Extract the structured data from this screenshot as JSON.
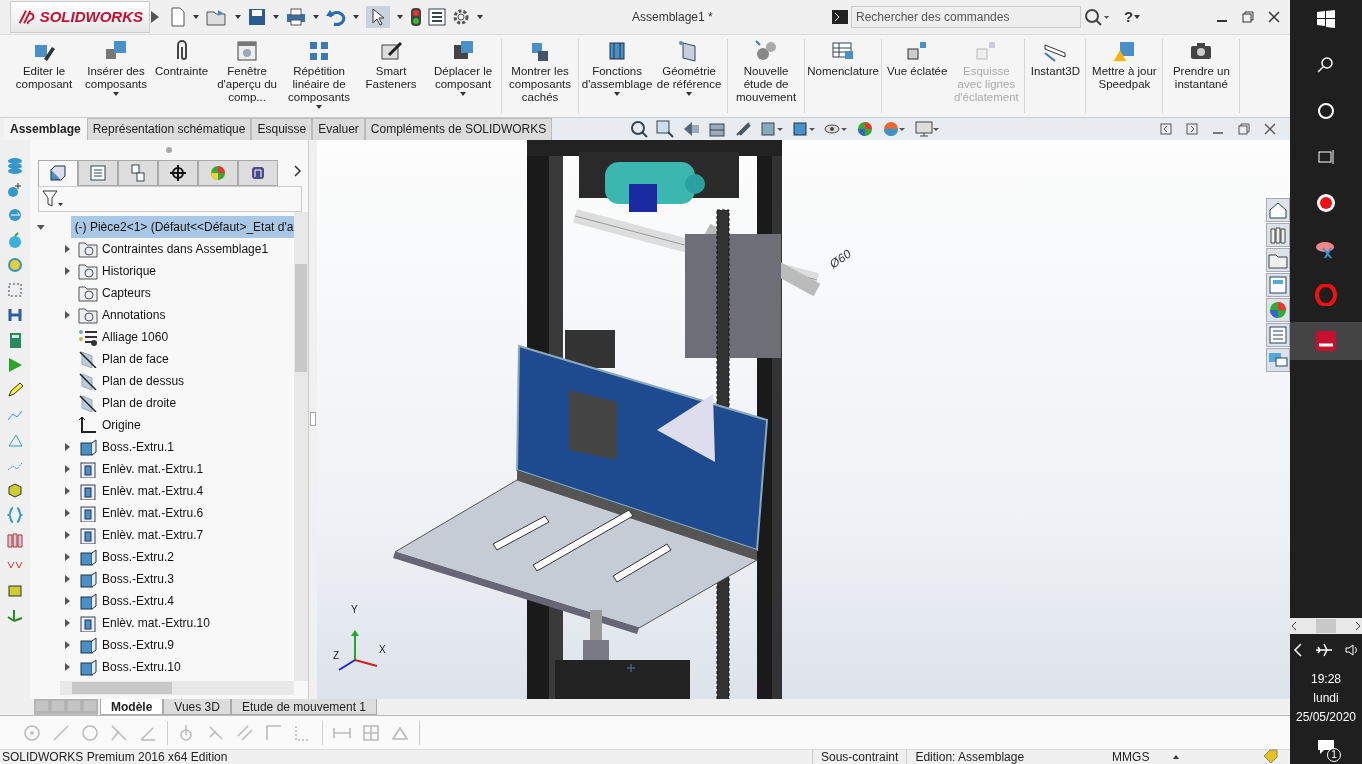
{
  "app": {
    "logo": "SOLIDWORKS",
    "title": "Assemblage1 *",
    "search": {
      "placeholder": "Rechercher des commandes"
    },
    "help": "?"
  },
  "ribbon": [
    {
      "items": [
        {
          "label": "Editer le composant",
          "dropdown": false,
          "disabled": false
        },
        {
          "label": "Insérer des composants",
          "dropdown": true,
          "disabled": false
        },
        {
          "label": "Contrainte",
          "dropdown": false,
          "disabled": false
        },
        {
          "label": "Fenêtre d'aperçu du comp...",
          "dropdown": false,
          "disabled": false
        },
        {
          "label": "Répétition linéaire de composants",
          "dropdown": true,
          "disabled": false
        },
        {
          "label": "Smart Fasteners",
          "dropdown": false,
          "disabled": false
        },
        {
          "label": "Déplacer le composant",
          "dropdown": true,
          "disabled": false
        }
      ]
    },
    {
      "items": [
        {
          "label": "Montrer les composants cachés",
          "dropdown": false,
          "disabled": false
        }
      ]
    },
    {
      "items": [
        {
          "label": "Fonctions d'assemblage",
          "dropdown": true,
          "disabled": false
        },
        {
          "label": "Géométrie de référence",
          "dropdown": true,
          "disabled": false
        }
      ]
    },
    {
      "items": [
        {
          "label": "Nouvelle étude de mouvement",
          "dropdown": false,
          "disabled": false
        }
      ]
    },
    {
      "items": [
        {
          "label": "Nomenclature",
          "dropdown": false,
          "disabled": false
        }
      ]
    },
    {
      "items": [
        {
          "label": "Vue éclatée",
          "dropdown": false,
          "disabled": false
        },
        {
          "label": "Esquisse avec lignes d'éclatement",
          "dropdown": false,
          "disabled": true
        }
      ]
    },
    {
      "items": [
        {
          "label": "Instant3D",
          "dropdown": false,
          "disabled": false
        }
      ]
    },
    {
      "items": [
        {
          "label": "Mettre à jour Speedpak",
          "dropdown": false,
          "disabled": false
        }
      ]
    },
    {
      "items": [
        {
          "label": "Prendre un instantané",
          "dropdown": false,
          "disabled": false
        }
      ]
    }
  ],
  "command_tabs": [
    {
      "label": "Assemblage",
      "selected": true
    },
    {
      "label": "Représentation schématique",
      "selected": false
    },
    {
      "label": "Esquisse",
      "selected": false
    },
    {
      "label": "Evaluer",
      "selected": false
    },
    {
      "label": "Compléments de SOLIDWORKS",
      "selected": false
    }
  ],
  "feature_tree": {
    "root": {
      "label": "(-) Pièce2<1> (Défaut<<Défaut>_Etat d'a",
      "expanded": true,
      "selected": true
    },
    "items": [
      {
        "label": "Contraintes dans Assemblage1",
        "kind": "folder",
        "expandable": true,
        "selected": false
      },
      {
        "label": "Historique",
        "kind": "folder",
        "expandable": true,
        "selected": false
      },
      {
        "label": "Capteurs",
        "kind": "folder",
        "expandable": false,
        "selected": false
      },
      {
        "label": "Annotations",
        "kind": "folder",
        "expandable": true,
        "selected": false
      },
      {
        "label": "Alliage 1060",
        "kind": "material",
        "expandable": false,
        "selected": false
      },
      {
        "label": "Plan de face",
        "kind": "plane",
        "expandable": false,
        "selected": false
      },
      {
        "label": "Plan de dessus",
        "kind": "plane",
        "expandable": false,
        "selected": false
      },
      {
        "label": "Plan de droite",
        "kind": "plane",
        "expandable": false,
        "selected": false
      },
      {
        "label": "Origine",
        "kind": "origin",
        "expandable": false,
        "selected": false
      },
      {
        "label": "Boss.-Extru.1",
        "kind": "boss",
        "expandable": true,
        "selected": false
      },
      {
        "label": "Enlèv. mat.-Extru.1",
        "kind": "cut",
        "expandable": true,
        "selected": false
      },
      {
        "label": "Enlèv. mat.-Extru.4",
        "kind": "cut",
        "expandable": true,
        "selected": false
      },
      {
        "label": "Enlèv. mat.-Extru.6",
        "kind": "cut",
        "expandable": true,
        "selected": false
      },
      {
        "label": "Enlèv. mat.-Extru.7",
        "kind": "cut",
        "expandable": true,
        "selected": false
      },
      {
        "label": "Boss.-Extru.2",
        "kind": "boss",
        "expandable": true,
        "selected": false
      },
      {
        "label": "Boss.-Extru.3",
        "kind": "boss",
        "expandable": true,
        "selected": false
      },
      {
        "label": "Boss.-Extru.4",
        "kind": "boss",
        "expandable": true,
        "selected": false
      },
      {
        "label": "Enlèv. mat.-Extru.10",
        "kind": "cut",
        "expandable": true,
        "selected": false
      },
      {
        "label": "Boss.-Extru.9",
        "kind": "boss",
        "expandable": true,
        "selected": false
      },
      {
        "label": "Boss.-Extru.10",
        "kind": "boss",
        "expandable": true,
        "selected": false
      }
    ]
  },
  "viewport": {
    "dimension": "Ø60",
    "axes": {
      "y": "Y",
      "z": "Z",
      "x": "X"
    }
  },
  "model_tabs": [
    {
      "label": "Modèle",
      "selected": true
    },
    {
      "label": "Vues 3D",
      "selected": false
    },
    {
      "label": "Etude de mouvement 1",
      "selected": false
    }
  ],
  "status_bar": {
    "product": "SOLIDWORKS Premium 2016 x64 Edition",
    "state": "Sous-contraint",
    "mode": "Edition: Assemblage",
    "units": "MMGS"
  },
  "taskbar": {
    "time": "19:28",
    "day": "lundi",
    "date": "25/05/2020",
    "notifications": "1"
  }
}
